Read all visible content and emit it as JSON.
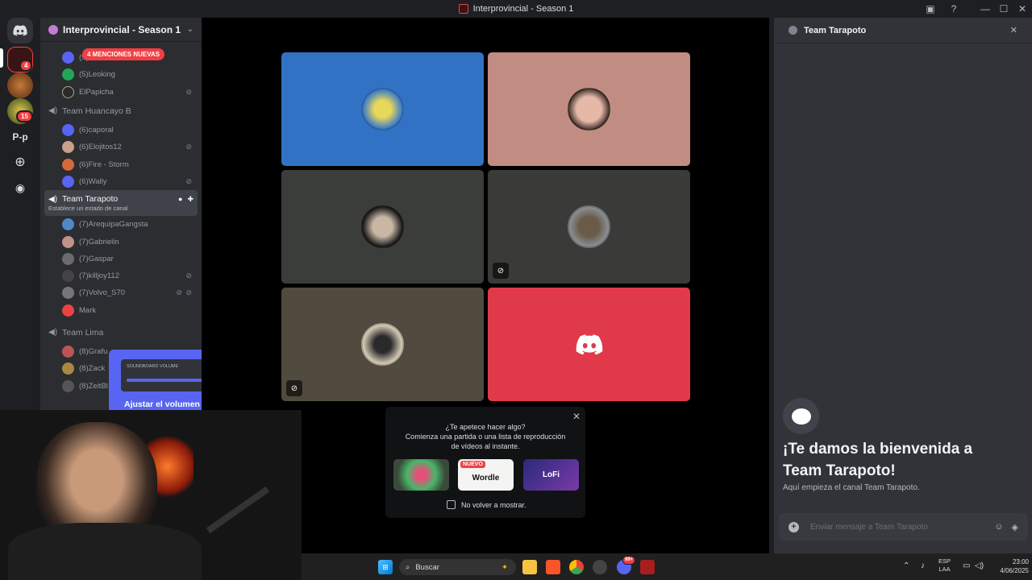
{
  "window": {
    "title": "Interprovincial - Season 1"
  },
  "rail": {
    "servers": [
      {
        "label": "P-p"
      }
    ],
    "badges": [
      "4",
      "15"
    ]
  },
  "sidebar": {
    "server_name": "Interprovincial - Season 1",
    "mentions_label": "4 MENCIONES NUEVAS",
    "top_members": [
      {
        "name": "(5)JuniorSmith"
      },
      {
        "name": "(5)Leoking"
      },
      {
        "name": "ElPapicha",
        "muted": true
      }
    ],
    "channels": [
      {
        "name": "Team Huancayo B",
        "members": [
          {
            "name": "(6)caporal"
          },
          {
            "name": "(6)Elojitos12",
            "muted": true
          },
          {
            "name": "(6)Fire - Storm"
          },
          {
            "name": "(6)Wally",
            "muted": true
          }
        ]
      },
      {
        "name": "Team Tarapoto",
        "status": "Establece un estado de canal",
        "members": [
          {
            "name": "(7)ArequipaGangsta"
          },
          {
            "name": "(7)Gabrielin"
          },
          {
            "name": "(7)Gaspar"
          },
          {
            "name": "(7)killjoy112",
            "muted": true
          },
          {
            "name": "(7)Volvo_S70",
            "muted": true,
            "deafened": true
          },
          {
            "name": "Mark"
          }
        ]
      },
      {
        "name": "Team Lima",
        "members": [
          {
            "name": "(8)Grafu"
          },
          {
            "name": "(8)Zack"
          },
          {
            "name": "(8)ZeitBl"
          }
        ]
      }
    ]
  },
  "soundboard": {
    "label": "SOUNDBOARD VOLUME",
    "level": 0.85,
    "text": "Ajustar el volumen del panel de"
  },
  "activity": {
    "question": "¿Te apetece hacer algo?",
    "body_line1": "Comienza una partida o una lista de reproducción",
    "body_line2": "de vídeos al instante.",
    "tiles": [
      {
        "label": ""
      },
      {
        "label": "Wordle",
        "tag": "NUEVO"
      },
      {
        "label": "LoFi"
      }
    ],
    "dont_show": "No volver a mostrar."
  },
  "chat": {
    "channel": "Team Tarapoto",
    "welcome_line1": "¡Te damos la bienvenida a",
    "welcome_line2": "Team Tarapoto!",
    "subtitle": "Aquí empieza el canal Team Tarapoto.",
    "placeholder": "Enviar mensaje a Team Tarapoto"
  },
  "taskbar": {
    "search": "Buscar",
    "lang1": "ESP",
    "lang2": "LAA",
    "time": "23:00",
    "date": "4/06/2025",
    "discord_badge": "99+"
  },
  "colors": {
    "blurple": "#5865f2",
    "red": "#ed4245",
    "green": "#23a559"
  }
}
